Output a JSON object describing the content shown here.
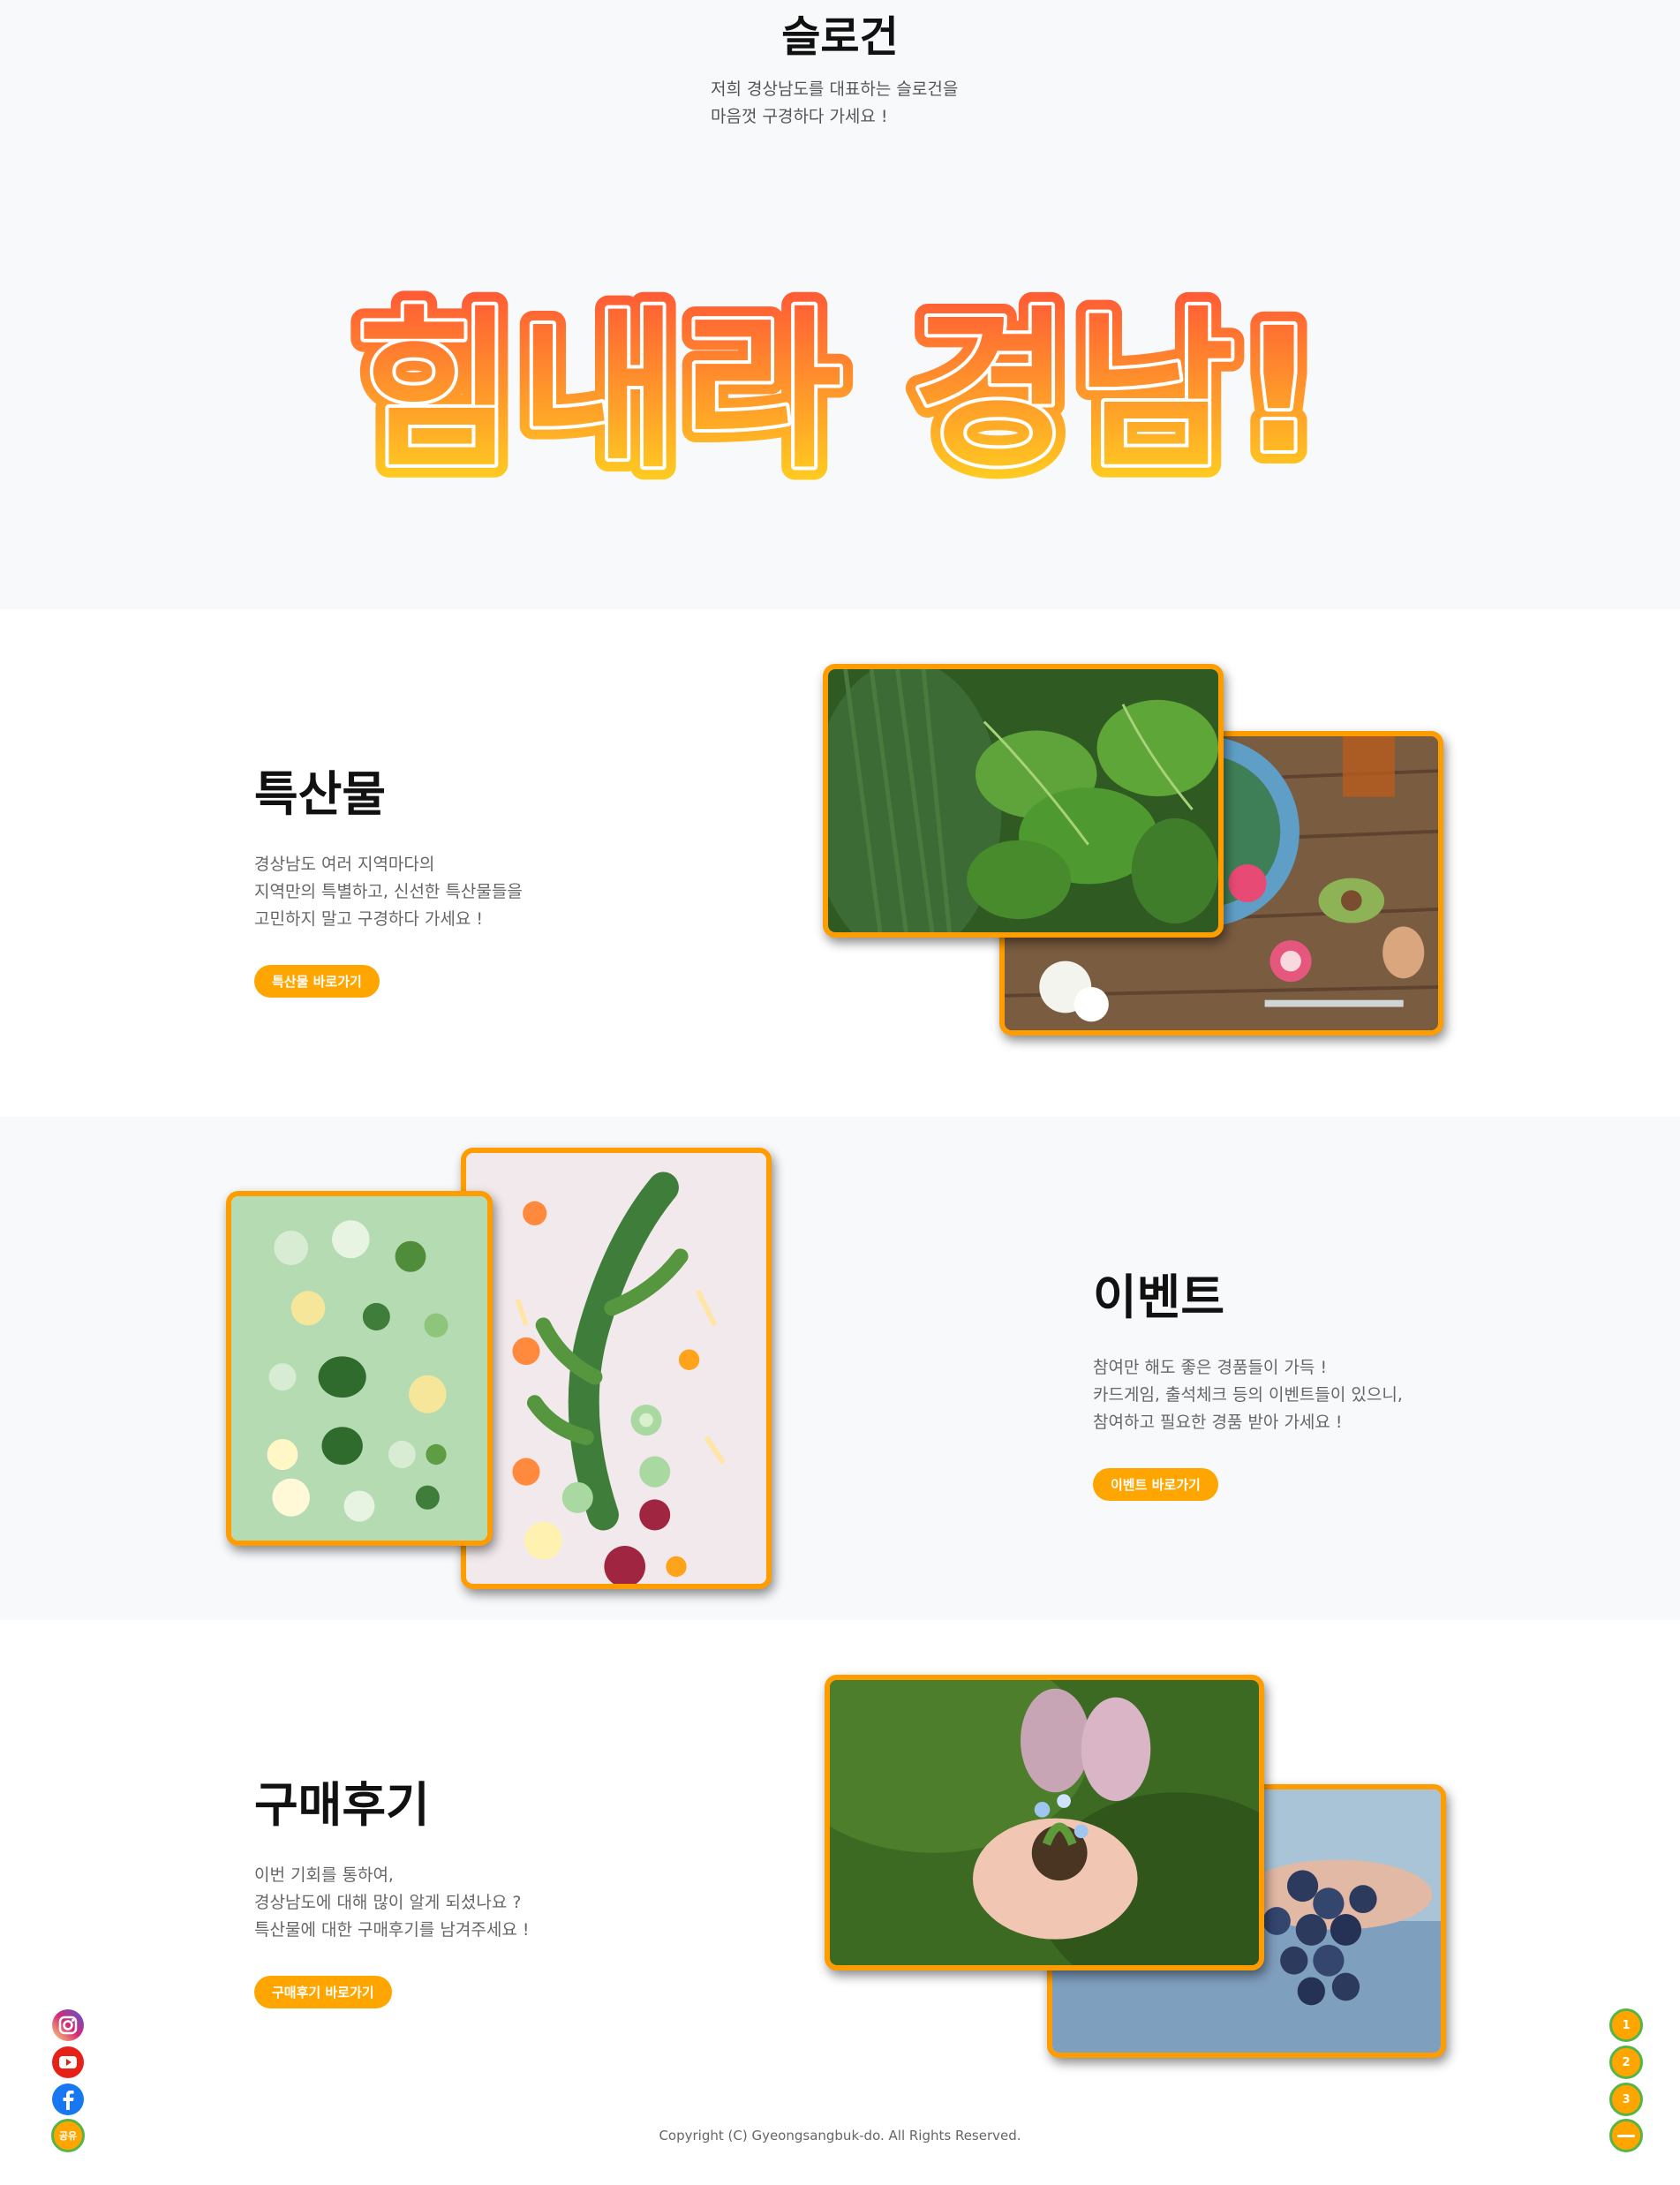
{
  "slogan": {
    "title": "슬로건",
    "desc": "저희 경상남도를 대표하는 슬로건을\n마음껏 구경하다 가세요 !",
    "headline": "힘내라 경남!",
    "colors": {
      "top": "#ff5a36",
      "bottom": "#ffd21f",
      "outline": "#ffffff"
    }
  },
  "products": {
    "title": "특산물",
    "desc": "경상남도 여러 지역마다의\n지역만의 특별하고, 신선한 특산물들을\n고민하지 말고 구경하다 가세요 !",
    "button": "특산물 바로가기"
  },
  "event": {
    "title": "이벤트",
    "desc": "참여만 해도 좋은 경품들이 가득 !\n카드게임, 출석체크 등의 이벤트들이 있으니,\n참여하고 필요한 경품 받아 가세요 !",
    "button": "이벤트 바로가기"
  },
  "review": {
    "title": "구매후기",
    "desc": "이번 기회를 통하여,\n경상남도에 대해 많이 알게 되셨나요 ?\n특산물에 대한 구매후기를 남겨주세요 !",
    "button": "구매후기 바로가기"
  },
  "social": {
    "items": [
      {
        "icon": "instagram-icon"
      },
      {
        "icon": "youtube-icon"
      },
      {
        "icon": "facebook-icon"
      }
    ],
    "share_label": "공유"
  },
  "pager": {
    "items": [
      "1",
      "2",
      "3"
    ],
    "menu_icon": "minus-icon"
  },
  "footer": {
    "copyright": "Copyright (C) Gyeongsangbuk-do. All Rights Reserved."
  },
  "accent_color": "#ffa500"
}
